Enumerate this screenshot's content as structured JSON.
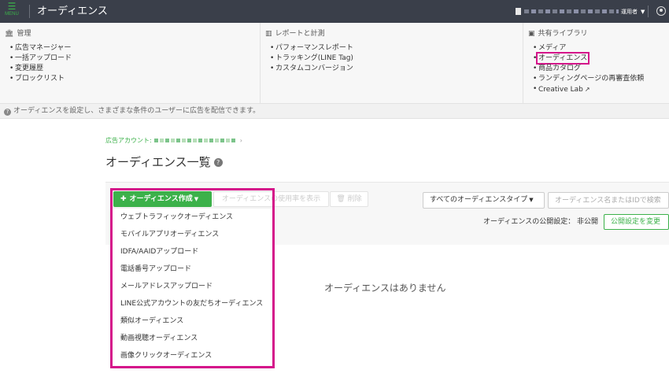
{
  "topbar": {
    "menu_label": "MENU",
    "app_title": "オーディエンス",
    "account_role": "運用者",
    "icons": {
      "menu": "hamburger-icon",
      "account": "building-icon",
      "user": "user-circle-icon"
    },
    "colors": {
      "bar": "#3a3f4a",
      "accent": "#3cb14a"
    }
  },
  "megamenu": {
    "management": {
      "heading": "管理",
      "items": [
        "広告マネージャー",
        "一括アップロード",
        "変更履歴",
        "ブロックリスト"
      ]
    },
    "reports": {
      "heading": "レポートと計測",
      "items": [
        "パフォーマンスレポート",
        "トラッキング(LINE Tag)",
        "カスタムコンバージョン"
      ]
    },
    "library": {
      "heading": "共有ライブラリ",
      "items": [
        "メディア",
        "オーディエンス",
        "商品カタログ",
        "ランディングページの再審査依頼",
        "Creative Lab"
      ]
    }
  },
  "info": {
    "text": "オーディエンスを設定し、さまざまな条件のユーザーに広告を配信できます。"
  },
  "breadcrumb": {
    "label": "広告アカウント:",
    "separator": "›"
  },
  "page": {
    "title": "オーディエンス一覧",
    "help": "?",
    "empty_message": "オーディエンスはありません"
  },
  "toolbar": {
    "create_label": "オーディエンス作成",
    "usage_label": "オーディエンスの使用率を表示",
    "delete_label": "削除",
    "type_select": "すべてのオーディエンスタイプ",
    "search_placeholder": "オーディエンス名またはIDで検索"
  },
  "publish": {
    "label": "オーディエンスの公開設定： 非公開",
    "button": "公開設定を変更"
  },
  "dropdown": {
    "items": [
      "ウェブトラフィックオーディエンス",
      "モバイルアプリオーディエンス",
      "IDFA/AAIDアップロード",
      "電話番号アップロード",
      "メールアドレスアップロード",
      "LINE公式アカウントの友だちオーディエンス",
      "類似オーディエンス",
      "動画視聴オーディエンス",
      "画像クリックオーディエンス"
    ]
  }
}
